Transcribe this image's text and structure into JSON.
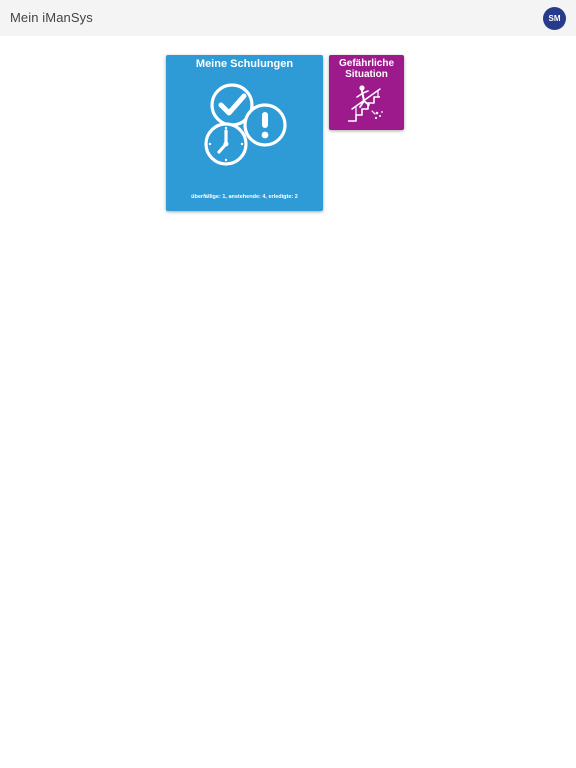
{
  "header": {
    "title": "Mein iManSys",
    "avatar_initials": "SM",
    "avatar_color": "#283a8c"
  },
  "tiles": [
    {
      "title": "Meine Schulungen",
      "subtitle": "überfällige: 1, anstehende: 4, erledigte: 2",
      "color": "#2e9bd6",
      "icon": "training-status-icon"
    },
    {
      "title": "Gefährliche Situation",
      "color": "#9c1a8c",
      "icon": "hazard-stairs-icon"
    }
  ]
}
